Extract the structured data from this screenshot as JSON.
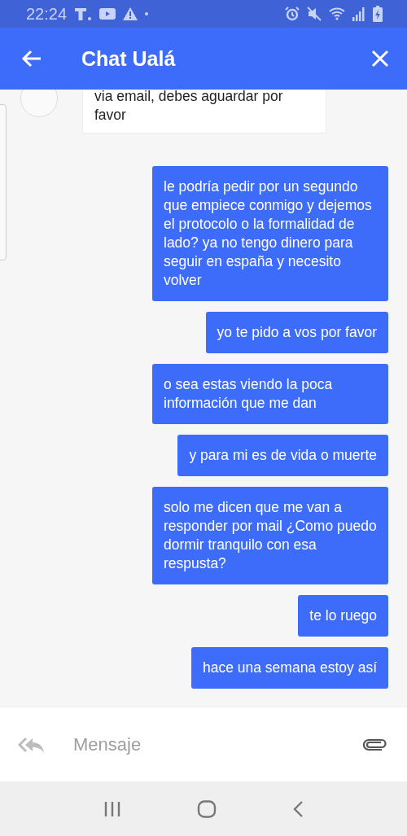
{
  "status_bar": {
    "time": "22:24"
  },
  "header": {
    "title": "Chat Ualá"
  },
  "messages": [
    {
      "kind": "agent",
      "text": "via email, debes aguardar por favor"
    },
    {
      "kind": "user",
      "text": "le podría pedir por un segundo que empiece conmigo y dejemos el protocolo o la formalidad de lado? ya no tengo dinero para seguir en españa y necesito volver"
    },
    {
      "kind": "user",
      "text": "yo te pido a vos por favor"
    },
    {
      "kind": "user",
      "text": "o sea estas viendo la poca información que me dan"
    },
    {
      "kind": "user",
      "text": "y para mi es de vida o muerte"
    },
    {
      "kind": "user",
      "text": "solo me dicen que me van a responder por mail ¿Como puedo dormir tranquilo con esa respusta?"
    },
    {
      "kind": "user",
      "text": "te lo ruego"
    },
    {
      "kind": "user",
      "text": "hace una semana estoy así"
    }
  ],
  "composer": {
    "placeholder": "Mensaje"
  }
}
